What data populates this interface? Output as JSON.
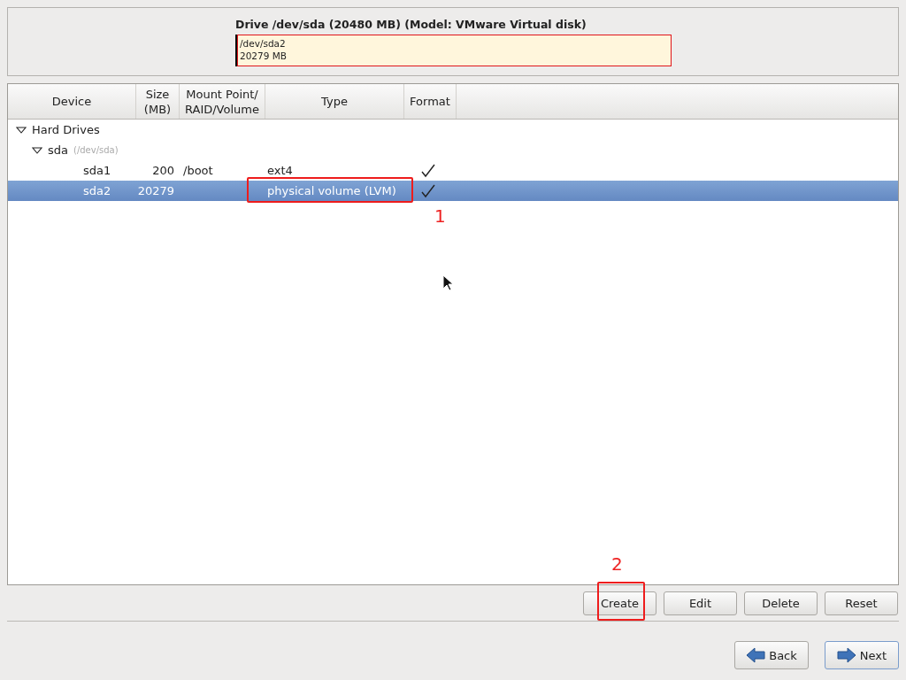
{
  "drive": {
    "title": "Drive /dev/sda (20480 MB) (Model: VMware Virtual disk)",
    "partitions": [
      {
        "name": "/dev/sda2",
        "size": "20279 MB",
        "selected": true
      }
    ]
  },
  "table": {
    "columns": [
      "Device",
      "Size\n(MB)",
      "Mount Point/\nRAID/Volume",
      "Type",
      "Format"
    ],
    "tree": [
      {
        "device": "Hard Drives",
        "expanded": true,
        "children": [
          {
            "device": "sda",
            "detail": "(/dev/sda)",
            "expanded": true,
            "children": [
              {
                "device": "sda1",
                "size": "200",
                "mount": "/boot",
                "type": "ext4",
                "format": true,
                "selected": false
              },
              {
                "device": "sda2",
                "size": "20279",
                "type": "physical volume (LVM)",
                "format": true,
                "selected": true,
                "annotation": "1"
              }
            ]
          }
        ]
      }
    ]
  },
  "actions": [
    {
      "label": "Create",
      "annotation": "2"
    },
    {
      "label": "Edit"
    },
    {
      "label": "Delete"
    },
    {
      "label": "Reset"
    }
  ],
  "nav": [
    {
      "label": "Back",
      "kind": "back"
    },
    {
      "label": "Next",
      "kind": "next"
    }
  ]
}
